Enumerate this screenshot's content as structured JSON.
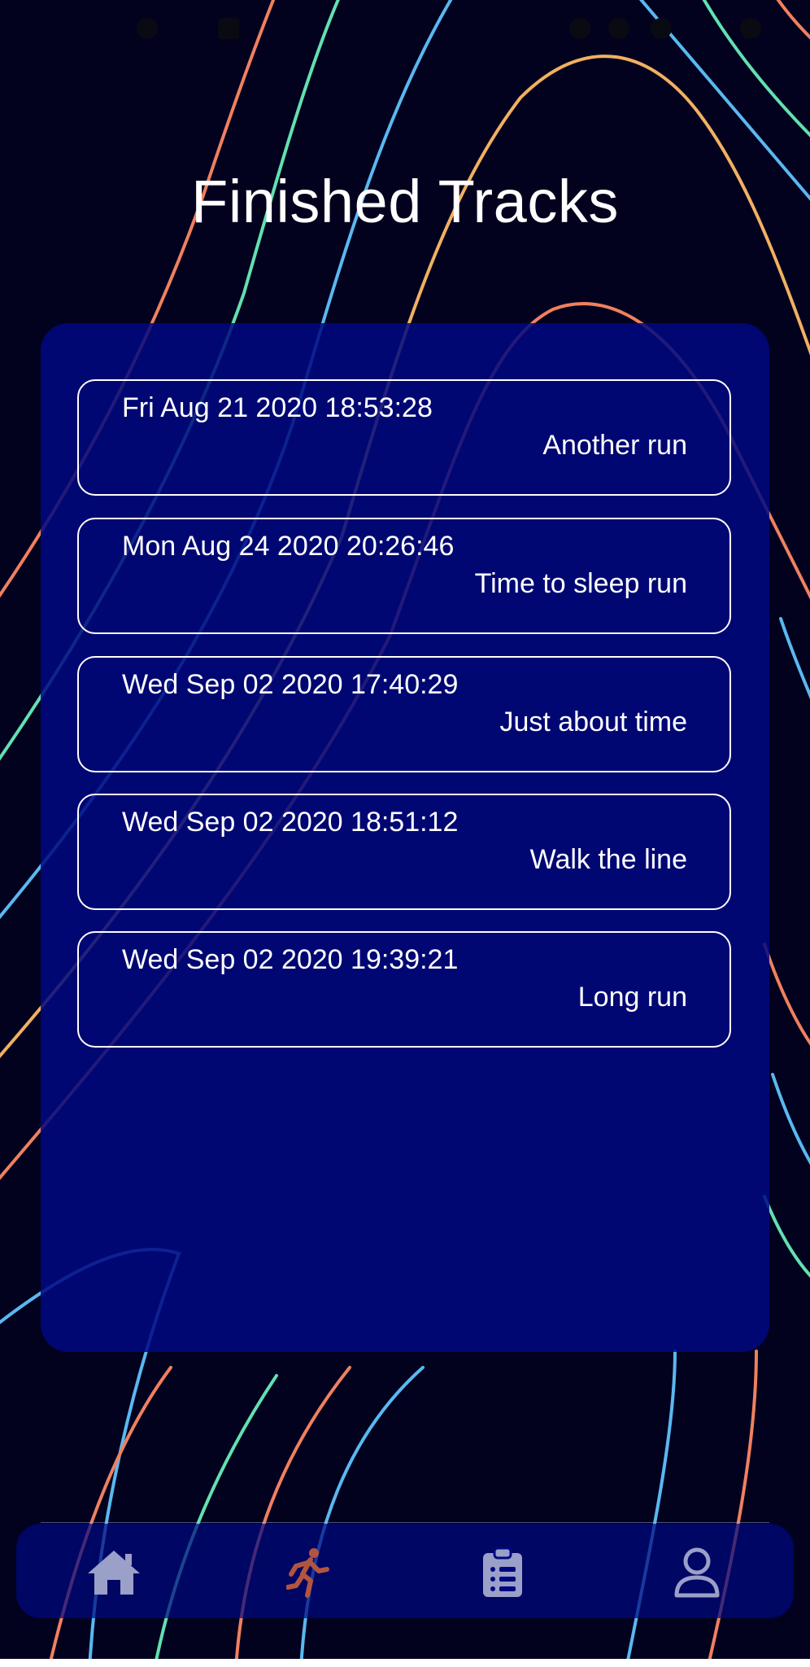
{
  "page": {
    "title": "Finished Tracks"
  },
  "tracks": [
    {
      "date": "Fri Aug 21 2020 18:53:28",
      "name": "Another run"
    },
    {
      "date": "Mon Aug 24 2020 20:26:46",
      "name": "Time to sleep run"
    },
    {
      "date": "Wed Sep 02 2020 17:40:29",
      "name": "Just about time"
    },
    {
      "date": "Wed Sep 02 2020 18:51:12",
      "name": "Walk the line"
    },
    {
      "date": "Wed Sep 02 2020 19:39:21",
      "name": "Long run"
    }
  ],
  "nav": {
    "items": [
      {
        "icon": "home-icon",
        "active": false
      },
      {
        "icon": "running-icon",
        "active": true
      },
      {
        "icon": "clipboard-list-icon",
        "active": false
      },
      {
        "icon": "user-icon",
        "active": false
      }
    ]
  },
  "colors": {
    "background": "#02021f",
    "panel": "#000880",
    "text": "#ffffff",
    "nav_icon": "#9aa0c8",
    "nav_active": "#b2553f",
    "line_orange": "#f0805f",
    "line_green": "#63e0b0",
    "line_blue": "#5ab8f0",
    "line_yellow": "#f2b060"
  }
}
